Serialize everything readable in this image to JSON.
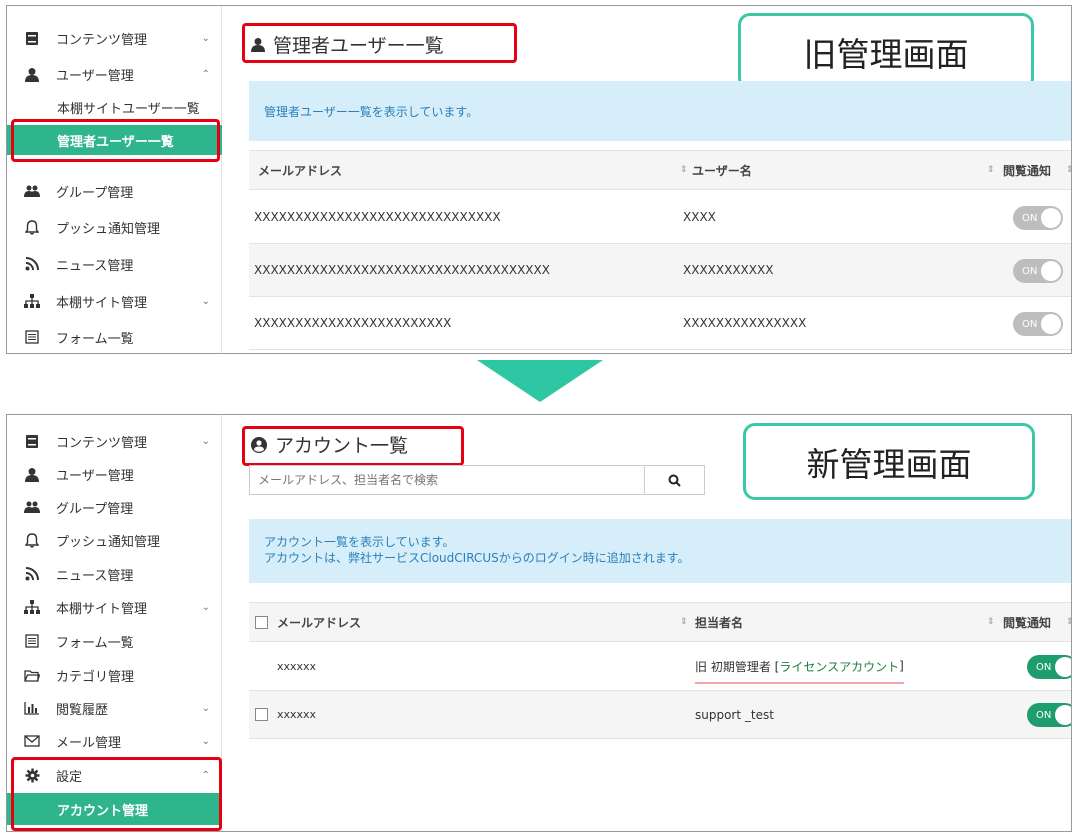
{
  "old_screen": {
    "badge": "旧管理画面",
    "sidebar": {
      "items": [
        {
          "label": "コンテンツ管理",
          "icon": "book-icon",
          "chevron": "⌄"
        },
        {
          "label": "ユーザー管理",
          "icon": "user-icon",
          "chevron": "⌃"
        },
        {
          "label": "グループ管理",
          "icon": "users-icon"
        },
        {
          "label": "プッシュ通知管理",
          "icon": "bell-icon"
        },
        {
          "label": "ニュース管理",
          "icon": "rss-icon"
        },
        {
          "label": "本棚サイト管理",
          "icon": "sitemap-icon",
          "chevron": "⌄"
        },
        {
          "label": "フォーム一覧",
          "icon": "form-icon"
        }
      ],
      "subitems": [
        {
          "label": "本棚サイトユーザー一覧",
          "active": false
        },
        {
          "label": "管理者ユーザー一覧",
          "active": true
        }
      ]
    },
    "title": "管理者ユーザー一覧",
    "info": "管理者ユーザー一覧を表示しています。",
    "table": {
      "headers": [
        "メールアドレス",
        "ユーザー名",
        "閲覧通知"
      ],
      "rows": [
        {
          "email": "XXXXXXXXXXXXXXXXXXXXXXXXXXXXXX",
          "name": "XXXX",
          "toggle": "ON"
        },
        {
          "email": "XXXXXXXXXXXXXXXXXXXXXXXXXXXXXXXXXXXX",
          "name": "XXXXXXXXXXX",
          "toggle": "ON"
        },
        {
          "email": "XXXXXXXXXXXXXXXXXXXXXXXX",
          "name": "XXXXXXXXXXXXXXX",
          "toggle": "ON"
        }
      ]
    }
  },
  "new_screen": {
    "badge": "新管理画面",
    "sidebar": {
      "items": [
        {
          "label": "コンテンツ管理",
          "icon": "book-icon",
          "chevron": "⌄"
        },
        {
          "label": "ユーザー管理",
          "icon": "user-icon"
        },
        {
          "label": "グループ管理",
          "icon": "users-icon"
        },
        {
          "label": "プッシュ通知管理",
          "icon": "bell-icon"
        },
        {
          "label": "ニュース管理",
          "icon": "rss-icon"
        },
        {
          "label": "本棚サイト管理",
          "icon": "sitemap-icon",
          "chevron": "⌄"
        },
        {
          "label": "フォーム一覧",
          "icon": "form-icon"
        },
        {
          "label": "カテゴリ管理",
          "icon": "folder-icon"
        },
        {
          "label": "閲覧履歴",
          "icon": "bar-chart-icon",
          "chevron": "⌄"
        },
        {
          "label": "メール管理",
          "icon": "mail-icon",
          "chevron": "⌄"
        },
        {
          "label": "設定",
          "icon": "gear-icon",
          "chevron": "⌃"
        }
      ],
      "subitems": [
        {
          "label": "アカウント管理",
          "active": true
        }
      ]
    },
    "title": "アカウント一覧",
    "search": {
      "placeholder": "メールアドレス、担当者名で検索"
    },
    "info_line1": "アカウント一覧を表示しています。",
    "info_line2": "アカウントは、弊社サービスCloudCIRCUSからのログイン時に追加されます。",
    "table": {
      "headers": [
        "メールアドレス",
        "担当者名",
        "閲覧通知"
      ],
      "rows": [
        {
          "email": "xxxxxx",
          "name_prefix": "旧 初期管理者 [",
          "name_highlight": "ライセンスアカウント",
          "name_suffix": "]",
          "toggle": "ON",
          "has_checkbox": false
        },
        {
          "email": "xxxxxx",
          "name": "support _test",
          "toggle": "ON",
          "has_checkbox": true
        }
      ]
    }
  },
  "colors": {
    "accent_green": "#2fb58c",
    "highlight_red": "#e60012",
    "badge_border": "#3cc7a5",
    "info_bg": "#d5eefa",
    "info_text": "#2c7fb8",
    "toggle_on": "#1e9e6e",
    "toggle_off": "#bdbdbd",
    "link_green": "#1a7f3c"
  }
}
